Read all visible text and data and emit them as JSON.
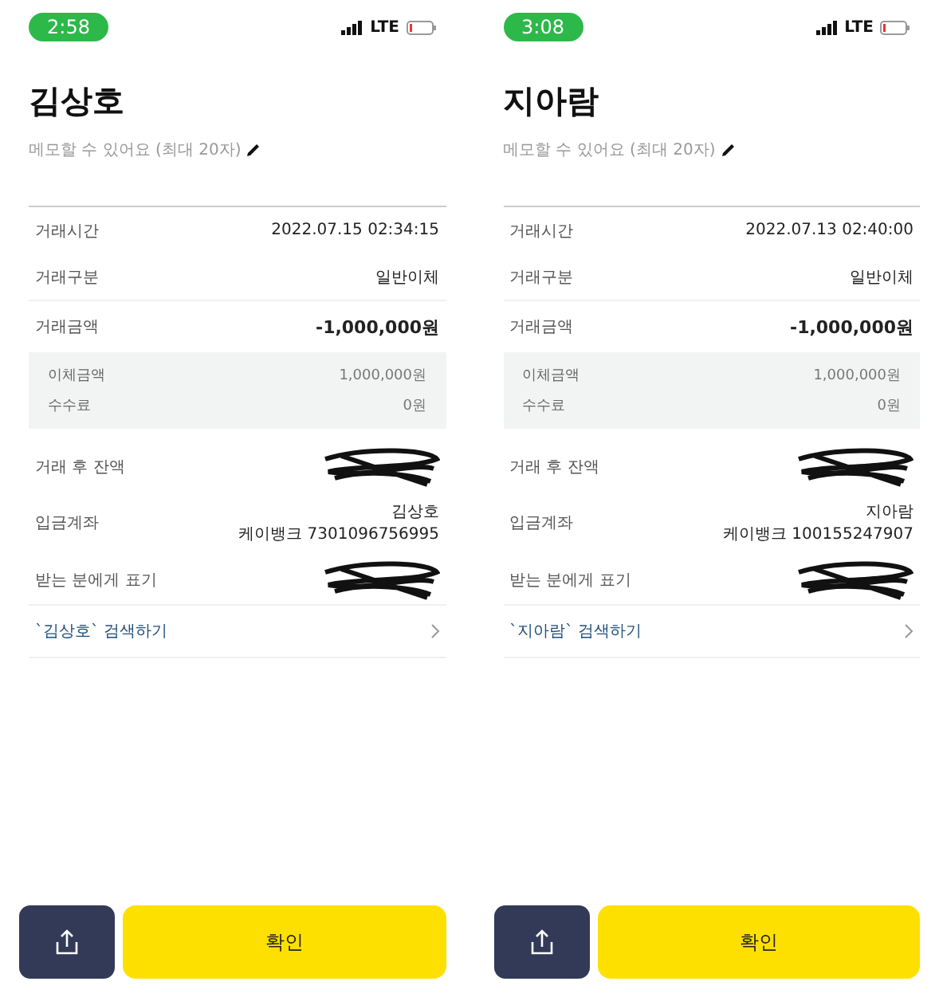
{
  "screens": [
    {
      "status": {
        "time": "2:58",
        "network": "LTE"
      },
      "title": "김상호",
      "memo_placeholder": "메모할 수 있어요 (최대 20자)",
      "details": [
        {
          "label": "거래시간",
          "value": "2022.07.15 02:34:15"
        },
        {
          "label": "거래구분",
          "value": "일반이체"
        }
      ],
      "amount": {
        "label": "거래금액",
        "value": "-1,000,000원"
      },
      "breakdown": [
        {
          "label": "이체금액",
          "value": "1,000,000원"
        },
        {
          "label": "수수료",
          "value": "0원"
        }
      ],
      "extra": [
        {
          "kind": "redacted",
          "label": "거래 후 잔액"
        },
        {
          "kind": "account",
          "label": "입금계좌",
          "lines": [
            "김상호",
            "케이뱅크 7301096756995"
          ]
        },
        {
          "kind": "redacted",
          "label": "받는 분에게 표기"
        }
      ],
      "search_link": "`김상호` 검색하기",
      "confirm": "확인"
    },
    {
      "status": {
        "time": "3:08",
        "network": "LTE"
      },
      "title": "지아람",
      "memo_placeholder": "메모할 수 있어요 (최대 20자)",
      "details": [
        {
          "label": "거래시간",
          "value": "2022.07.13 02:40:00"
        },
        {
          "label": "거래구분",
          "value": "일반이체"
        }
      ],
      "amount": {
        "label": "거래금액",
        "value": "-1,000,000원"
      },
      "breakdown": [
        {
          "label": "이체금액",
          "value": "1,000,000원"
        },
        {
          "label": "수수료",
          "value": "0원"
        }
      ],
      "extra": [
        {
          "kind": "redacted",
          "label": "거래 후 잔액"
        },
        {
          "kind": "account",
          "label": "입금계좌",
          "lines": [
            "지아람",
            "케이뱅크 100155247907"
          ]
        },
        {
          "kind": "redacted",
          "label": "받는 분에게 표기"
        }
      ],
      "search_link": "`지아람` 검색하기",
      "confirm": "확인"
    }
  ]
}
